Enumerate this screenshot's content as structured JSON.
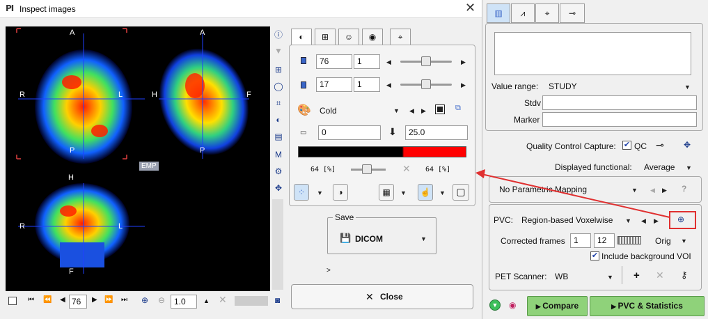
{
  "window": {
    "title": "Inspect images",
    "logo": "PI",
    "close_glyph": "✕"
  },
  "viewer": {
    "axial": {
      "top": "A",
      "bottom": "P",
      "left": "R",
      "right": "L"
    },
    "sagittal": {
      "top": "A",
      "bottom": "P",
      "left": "H",
      "right": "F"
    },
    "coronal": {
      "top": "H",
      "bottom": "F",
      "left": "R",
      "right": "L"
    },
    "emp_badge": "EMP"
  },
  "nav": {
    "slice": "76",
    "zoom": "1.0"
  },
  "controls": {
    "row1": {
      "value": "76",
      "step": "1"
    },
    "row2": {
      "value": "17",
      "step": "1"
    },
    "colormap": "Cold",
    "min": "0",
    "max": "25.0",
    "opacity_left": "64 [%]",
    "opacity_right": "64 [%]"
  },
  "save": {
    "legend": "Save",
    "format": "DICOM",
    "expand": ">"
  },
  "close_button": "Close",
  "right": {
    "value_range_label": "Value range:",
    "value_range": "STUDY",
    "stdv_label": "Stdv",
    "marker_label": "Marker",
    "qc_label": "Quality Control Capture:",
    "qc_checkbox": "QC",
    "displayed_functional_label": "Displayed functional:",
    "displayed_functional": "Average",
    "mapping": "No Parametric Mapping",
    "mapping_help": "?",
    "pvc_label": "PVC:",
    "pvc_method": "Region-based Voxelwise",
    "corrected_frames_label": "Corrected frames",
    "frames_from": "1",
    "frames_to": "12",
    "orig": "Orig",
    "include_bg": "Include background VOI",
    "pet_scanner_label": "PET Scanner:",
    "pet_scanner": "WB",
    "compare_button": "Compare",
    "pvc_stats_button": "PVC & Statistics"
  },
  "colors": {
    "accent": "#3a66c8",
    "highlight_red": "#e03030",
    "green_button": "#8fd27a"
  }
}
